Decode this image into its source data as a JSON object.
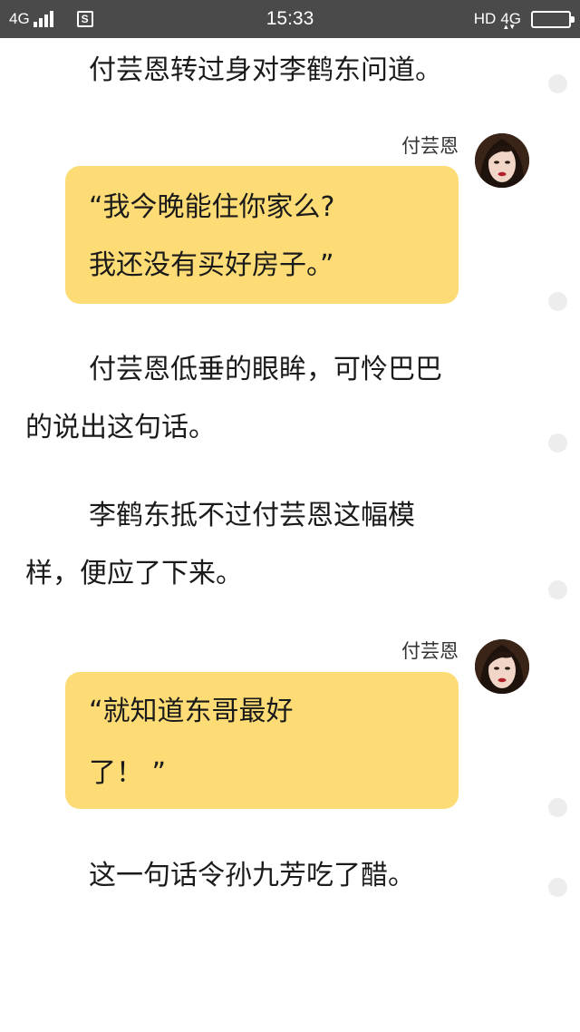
{
  "status_bar": {
    "network_left": "4G",
    "app_icon_letter": "S",
    "time": "15:33",
    "hd_label": "HD",
    "network_right": "4G",
    "network_arrows": "▲▼"
  },
  "story": {
    "para1": "付芸恩转过身对李鹤东问道。",
    "msg1": {
      "sender": "付芸恩",
      "line1": "“我今晚能住你家么?",
      "line2": "我还没有买好房子。”"
    },
    "para2_line1": "付芸恩低垂的眼眸，可怜巴巴",
    "para2_line2": "的说出这句话。",
    "para3_line1": "李鹤东抵不过付芸恩这幅模",
    "para3_line2": "样，便应了下来。",
    "msg2": {
      "sender": "付芸恩",
      "line1": "“就知道东哥最好",
      "line2": "了！ ”"
    },
    "para4": "这一句话令孙九芳吃了醋。"
  },
  "colors": {
    "status_bar_bg": "#4a4a4a",
    "bubble_bg": "#fddc76",
    "side_dot": "#ededed"
  },
  "icons": [
    "signal-bars-icon",
    "app-s-icon",
    "battery-icon",
    "avatar-image"
  ]
}
